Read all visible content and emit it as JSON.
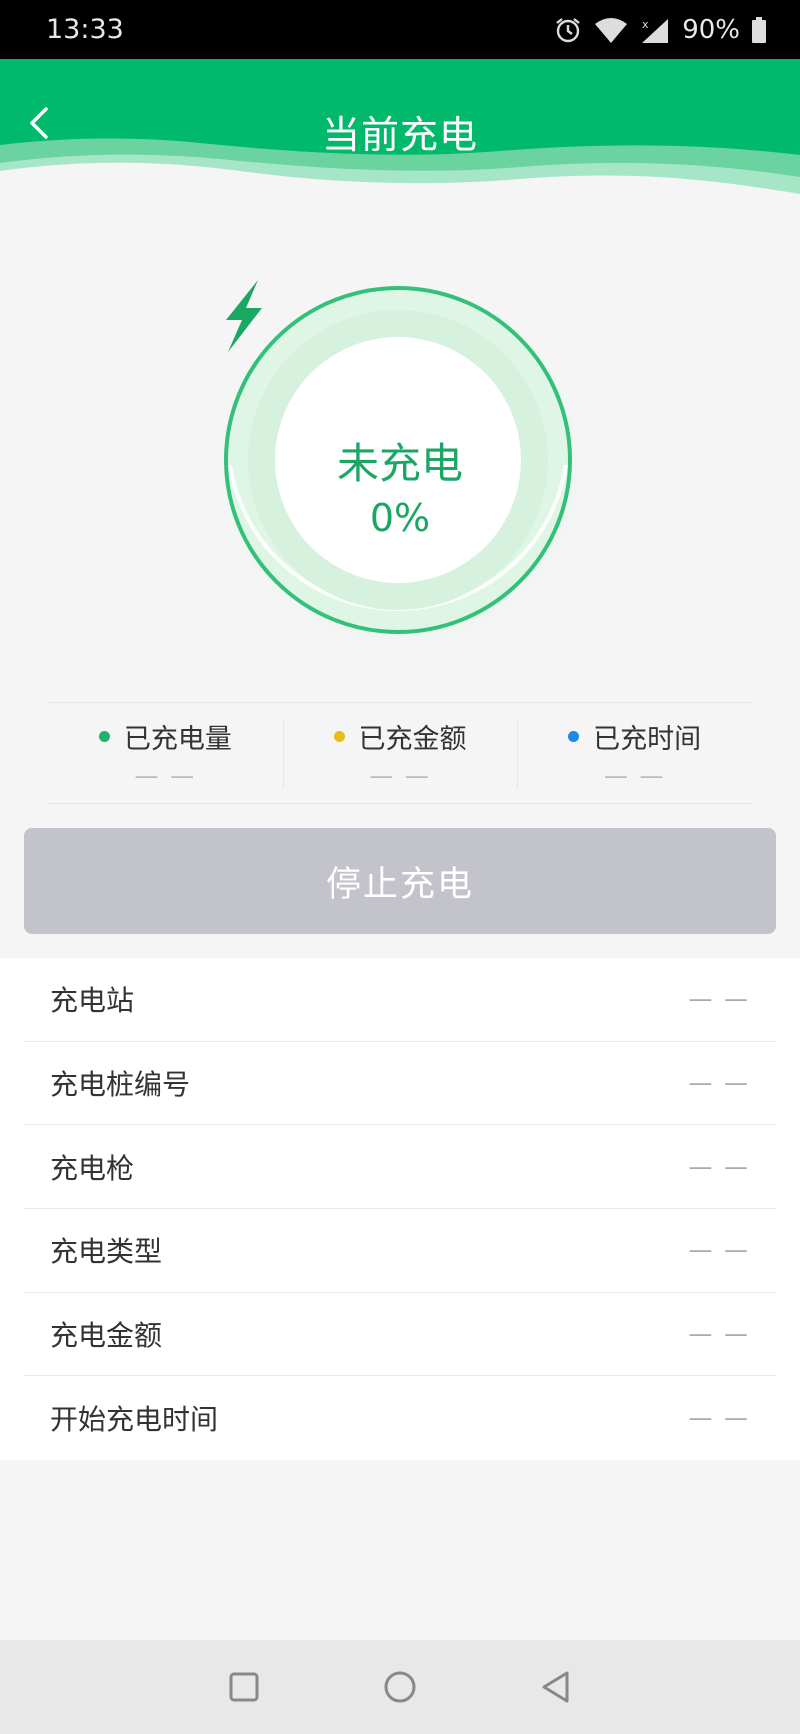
{
  "status_bar": {
    "time": "13:33",
    "battery": "90%",
    "icons": [
      "alarm-icon",
      "wifi-icon",
      "signal-icon",
      "battery-icon"
    ]
  },
  "header": {
    "title": "当前充电",
    "back_icon": "chevron-left-icon"
  },
  "gauge": {
    "status": "未充电",
    "percent": "0%",
    "progress_fraction": 0
  },
  "stats": [
    {
      "label": "已充电量",
      "value": "— —",
      "dot_color": "#1db36a"
    },
    {
      "label": "已充金额",
      "value": "— —",
      "dot_color": "#e6be1a"
    },
    {
      "label": "已充时间",
      "value": "— —",
      "dot_color": "#1e88e5"
    }
  ],
  "stop_button": {
    "label": "停止充电"
  },
  "info": [
    {
      "label": "充电站",
      "value": "— —"
    },
    {
      "label": "充电桩编号",
      "value": "— —"
    },
    {
      "label": "充电枪",
      "value": "— —"
    },
    {
      "label": "充电类型",
      "value": "— —"
    },
    {
      "label": "充电金额",
      "value": "— —"
    },
    {
      "label": "开始充电时间",
      "value": "— —"
    }
  ],
  "nav_bar": {
    "icons": [
      "square-recent-icon",
      "circle-home-icon",
      "triangle-back-icon"
    ]
  },
  "colors": {
    "brand_green": "#00b96b",
    "accent_text": "#1aa663",
    "disabled_button": "#c3c3cb"
  }
}
